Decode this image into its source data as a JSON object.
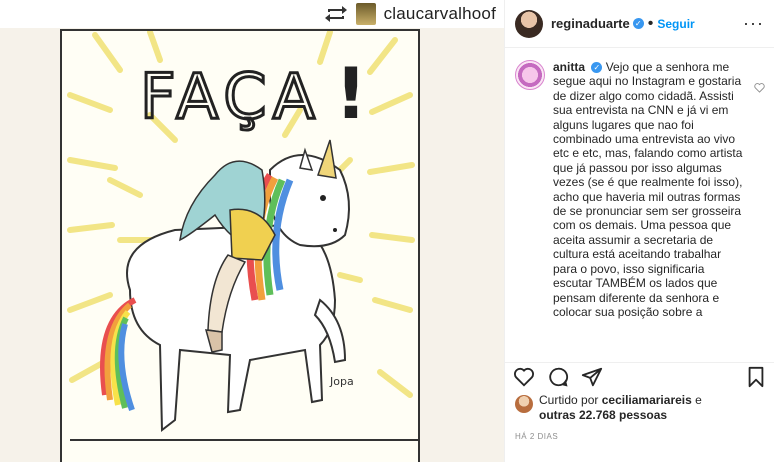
{
  "repost": {
    "username": "claucarvalhoof",
    "icon": "repost-icon"
  },
  "artwork": {
    "headline": "FAÇA",
    "exclamation": "!",
    "signature": "Jopa"
  },
  "post": {
    "author": "reginaduarte",
    "separator": "•",
    "follow_label": "Seguir",
    "more_label": "···"
  },
  "comment": {
    "author": "anitta",
    "text": "Vejo que a senhora me segue aqui no Instagram e gostaria de dizer algo como cidadã. Assisti sua entrevista na CNN e já vi em alguns lugares que nao foi combinado uma entrevista ao vivo etc e etc, mas, falando como artista que já passou por isso algumas vezes (se é que realmente foi isso), acho que haveria mil outras formas de se pronunciar sem ser grosseira com os demais. Uma pessoa que aceita assumir a secretaria de cultura está aceitando trabalhar para o povo, isso significaria escutar TAMBÉM os lados que pensam diferente da senhora e colocar sua posição sobre a"
  },
  "likes": {
    "prefix": "Curtido por",
    "first_user": "ceciliamariareis",
    "joiner": "e",
    "others": "outras 22.768 pessoas"
  },
  "timestamp": "HÁ 2 DIAS",
  "colors": {
    "accent": "#0095f6",
    "verified": "#3897f0",
    "sun_rays": "#f3e98a"
  }
}
